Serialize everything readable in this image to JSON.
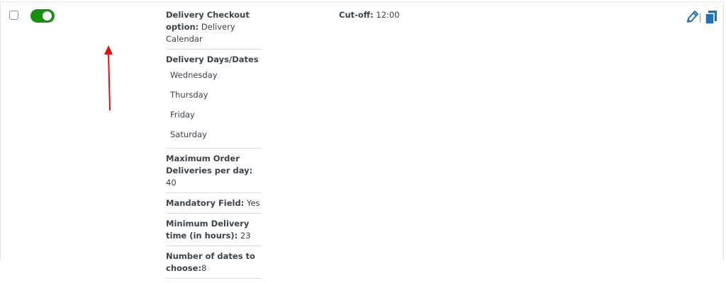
{
  "details": {
    "checkout_option_label": "Delivery Checkout option:",
    "checkout_option_value": "Delivery Calendar",
    "days_label": "Delivery Days/Dates",
    "days": [
      "Wednesday",
      "Thursday",
      "Friday",
      "Saturday"
    ],
    "max_orders_label": "Maximum Order Deliveries per day:",
    "max_orders_value": "40",
    "mandatory_label": "Mandatory Field:",
    "mandatory_value": "Yes",
    "min_time_label": "Minimum Delivery time (in hours):",
    "min_time_value": "23",
    "num_dates_label": "Number of dates to choose:",
    "num_dates_value": "8"
  },
  "cutoff": {
    "label": "Cut-off:",
    "value": "12:00"
  },
  "status": {
    "enabled": true
  },
  "colors": {
    "toggle_on": "#1a8f12",
    "arrow": "#e01010",
    "icon": "#2271b1"
  },
  "icons": {
    "edit": "pencil-icon",
    "copy": "duplicate-icon"
  }
}
